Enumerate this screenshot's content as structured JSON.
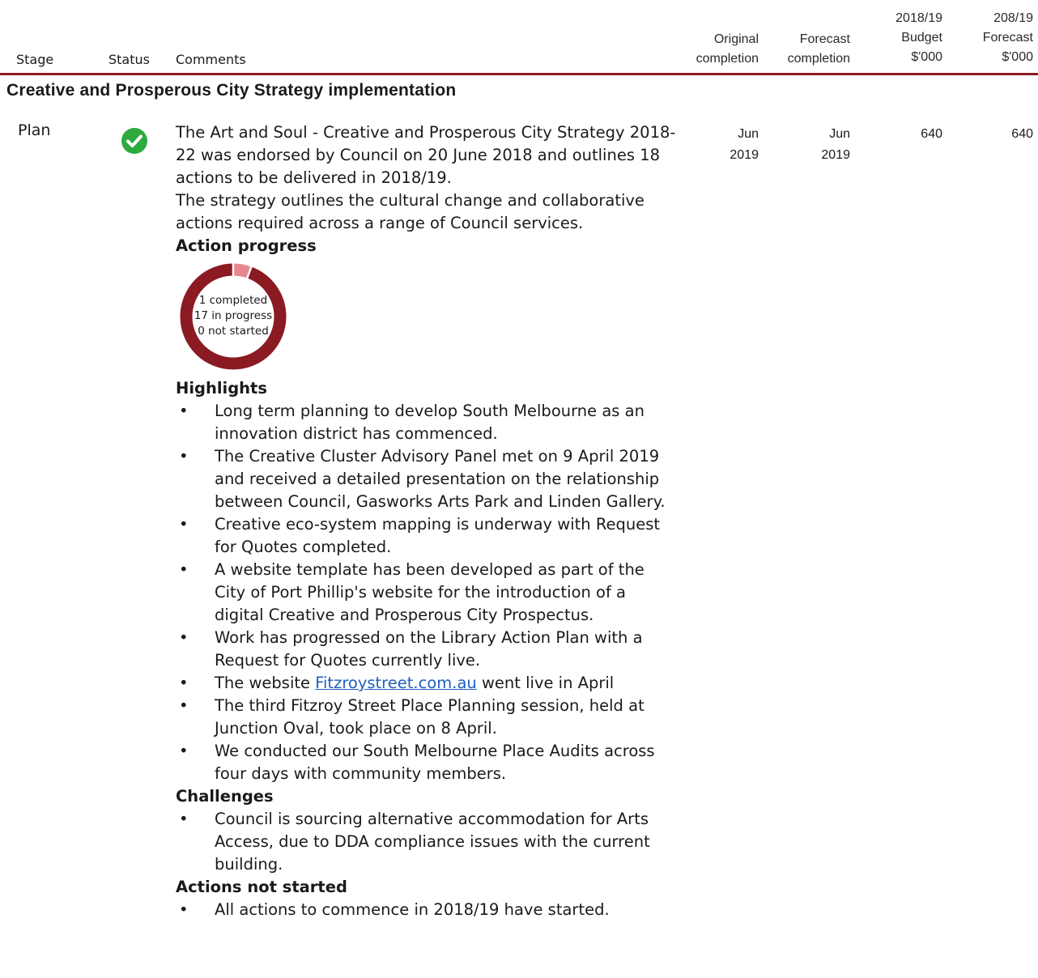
{
  "header": {
    "stage": "Stage",
    "status": "Status",
    "comments": "Comments",
    "original_completion": [
      "Original",
      "completion"
    ],
    "forecast_completion": [
      "Forecast",
      "completion"
    ],
    "budget": [
      "2018/19",
      "Budget",
      "$'000"
    ],
    "forecast": [
      "208/19",
      "Forecast",
      "$'000"
    ]
  },
  "section_title": "Creative and Prosperous City Strategy implementation",
  "row": {
    "stage": "Plan",
    "status_icon": "check-circle-icon",
    "status_color": "#2eaa3f",
    "original_completion": [
      "Jun",
      "2019"
    ],
    "forecast_completion": [
      "Jun",
      "2019"
    ],
    "budget": "640",
    "forecast": "640",
    "intro_1": "The Art and Soul - Creative and Prosperous City Strategy 2018-22 was endorsed by Council on 20 June 2018 and outlines 18 actions to be delivered in 2018/19.",
    "intro_2": "The strategy outlines the cultural change and collaborative actions required across a range of Council services.",
    "action_progress_heading": "Action progress",
    "action_progress": {
      "completed": 1,
      "in_progress": 17,
      "not_started": 0,
      "labels": [
        "1 completed",
        "17 in progress",
        "0 not started"
      ],
      "colors": {
        "completed": "#e8888e",
        "in_progress": "#8b1a22"
      }
    },
    "highlights_heading": "Highlights",
    "highlights": [
      "Long term planning to develop South Melbourne as an innovation district has commenced.",
      "The Creative Cluster Advisory Panel met on 9 April 2019 and received a detailed presentation on the relationship between Council, Gasworks Arts Park and Linden Gallery.",
      "Creative eco-system mapping is underway with Request for Quotes completed.",
      "A website template has been developed as part of the City of Port Phillip's website for the introduction of a digital Creative and Prosperous City Prospectus.",
      "Work has progressed on the Library Action Plan with a Request for Quotes currently live."
    ],
    "website_item": {
      "prefix": "The website ",
      "link": "Fitzroystreet.com.au",
      "suffix": " went live in April"
    },
    "highlights_after": [
      "The third Fitzroy Street Place Planning session, held at Junction Oval, took place on 8 April.",
      "We conducted our South Melbourne Place Audits across four days with community members."
    ],
    "challenges_heading": "Challenges",
    "challenges": [
      "Council is sourcing alternative accommodation for Arts Access, due to DDA compliance issues with the current building."
    ],
    "not_started_heading": "Actions not started",
    "not_started": [
      "All actions to commence in 2018/19 have started."
    ]
  },
  "accent_color": "#8b1a22"
}
